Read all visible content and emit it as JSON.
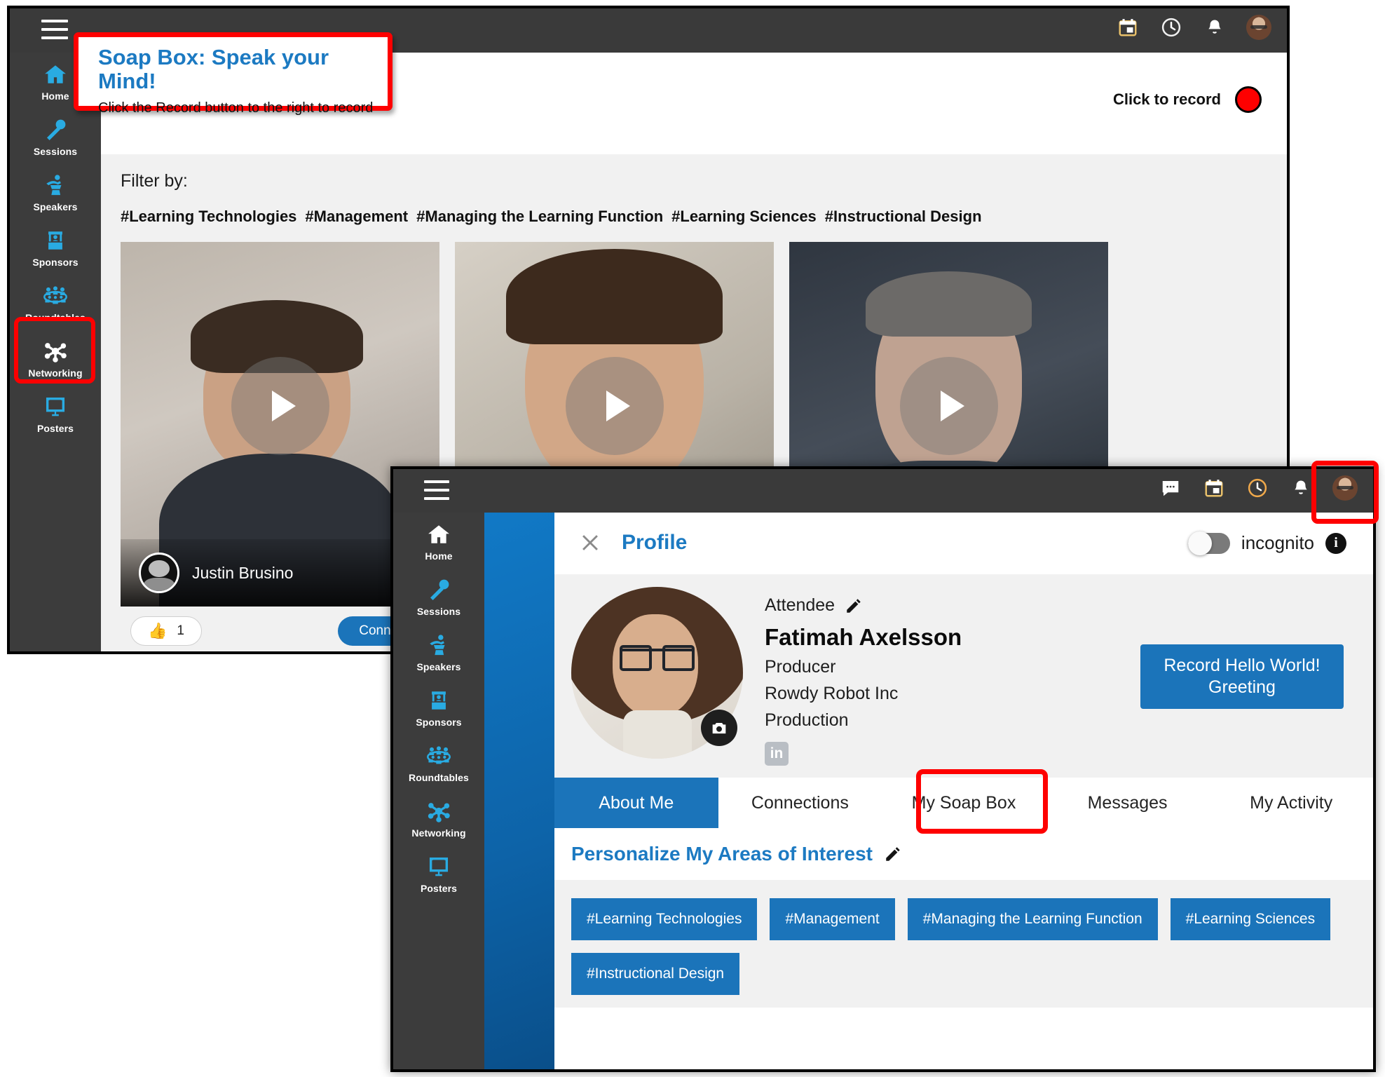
{
  "colors": {
    "accent_blue": "#1b74ba",
    "link_blue": "#1c7ac2",
    "icon_cyan": "#29abe2",
    "annotation_red": "#fe0000",
    "rail_bg": "#3c3c3c",
    "topbar_bg": "#3a3a3a",
    "page_bg": "#f1f1f1"
  },
  "window_back": {
    "topbar": {
      "menu_icon": "hamburger-icon",
      "icons": [
        "calendar-icon",
        "clock-icon",
        "bell-icon",
        "avatar"
      ]
    },
    "sidebar": {
      "items": [
        {
          "label": "Home",
          "icon": "home-icon",
          "active": false
        },
        {
          "label": "Sessions",
          "icon": "microphone-icon",
          "active": false
        },
        {
          "label": "Speakers",
          "icon": "podium-icon",
          "active": false
        },
        {
          "label": "Sponsors",
          "icon": "booth-icon",
          "active": false
        },
        {
          "label": "Roundtables",
          "icon": "roundtable-icon",
          "active": false
        },
        {
          "label": "Networking",
          "icon": "network-nodes-icon",
          "active": true
        },
        {
          "label": "Posters",
          "icon": "poster-board-icon",
          "active": false
        }
      ]
    },
    "callout": {
      "title": "Soap Box: Speak your Mind!",
      "subtitle": "Click the Record button to the right to record"
    },
    "record": {
      "label": "Click to record",
      "button_icon": "record-dot-icon"
    },
    "filter": {
      "label": "Filter by:",
      "tags": [
        "#Learning Technologies",
        "#Management",
        "#Managing the Learning Function",
        "#Learning Sciences",
        "#Instructional Design"
      ]
    },
    "video_cards": [
      {
        "name": "Justin Brusino",
        "likes": "1",
        "connect_label": "Connect",
        "play_icon": "play-icon"
      },
      {
        "name": "",
        "likes": "",
        "connect_label": "",
        "play_icon": "play-icon"
      },
      {
        "name": "",
        "likes": "",
        "connect_label": "",
        "play_icon": "play-icon"
      }
    ],
    "like_icon": "thumbs-up-icon"
  },
  "window_front": {
    "topbar": {
      "menu_icon": "hamburger-icon",
      "icons": [
        "chat-icon",
        "calendar-icon",
        "clock-icon",
        "bell-icon",
        "avatar"
      ]
    },
    "sidebar": {
      "items": [
        {
          "label": "Home",
          "icon": "home-icon",
          "active": true
        },
        {
          "label": "Sessions",
          "icon": "microphone-icon",
          "active": false
        },
        {
          "label": "Speakers",
          "icon": "podium-icon",
          "active": false
        },
        {
          "label": "Sponsors",
          "icon": "booth-icon",
          "active": false
        },
        {
          "label": "Roundtables",
          "icon": "roundtable-icon",
          "active": false
        },
        {
          "label": "Networking",
          "icon": "network-nodes-icon",
          "active": false
        },
        {
          "label": "Posters",
          "icon": "poster-board-icon",
          "active": false
        }
      ]
    },
    "panel": {
      "close_icon": "close-icon",
      "title": "Profile",
      "incognito": {
        "label": "incognito",
        "state": "off",
        "info_icon": "info-icon"
      },
      "profile": {
        "role_type": "Attendee",
        "edit_icon": "pencil-icon",
        "name": "Fatimah Axelsson",
        "job_title": "Producer",
        "company": "Rowdy Robot Inc",
        "department": "Production",
        "linkedin_badge": "in",
        "camera_icon": "camera-icon"
      },
      "record_button": {
        "line1": "Record Hello World!",
        "line2": "Greeting"
      },
      "tabs": [
        {
          "label": "About Me",
          "active": true,
          "highlighted": false
        },
        {
          "label": "Connections",
          "active": false,
          "highlighted": false
        },
        {
          "label": "My Soap Box",
          "active": false,
          "highlighted": true
        },
        {
          "label": "Messages",
          "active": false,
          "highlighted": false
        },
        {
          "label": "My Activity",
          "active": false,
          "highlighted": false
        }
      ],
      "interests": {
        "heading": "Personalize My Areas of Interest",
        "edit_icon": "pencil-icon",
        "chips": [
          "#Learning Technologies",
          "#Management",
          "#Managing the Learning Function",
          "#Learning Sciences",
          "#Instructional Design"
        ]
      }
    }
  }
}
